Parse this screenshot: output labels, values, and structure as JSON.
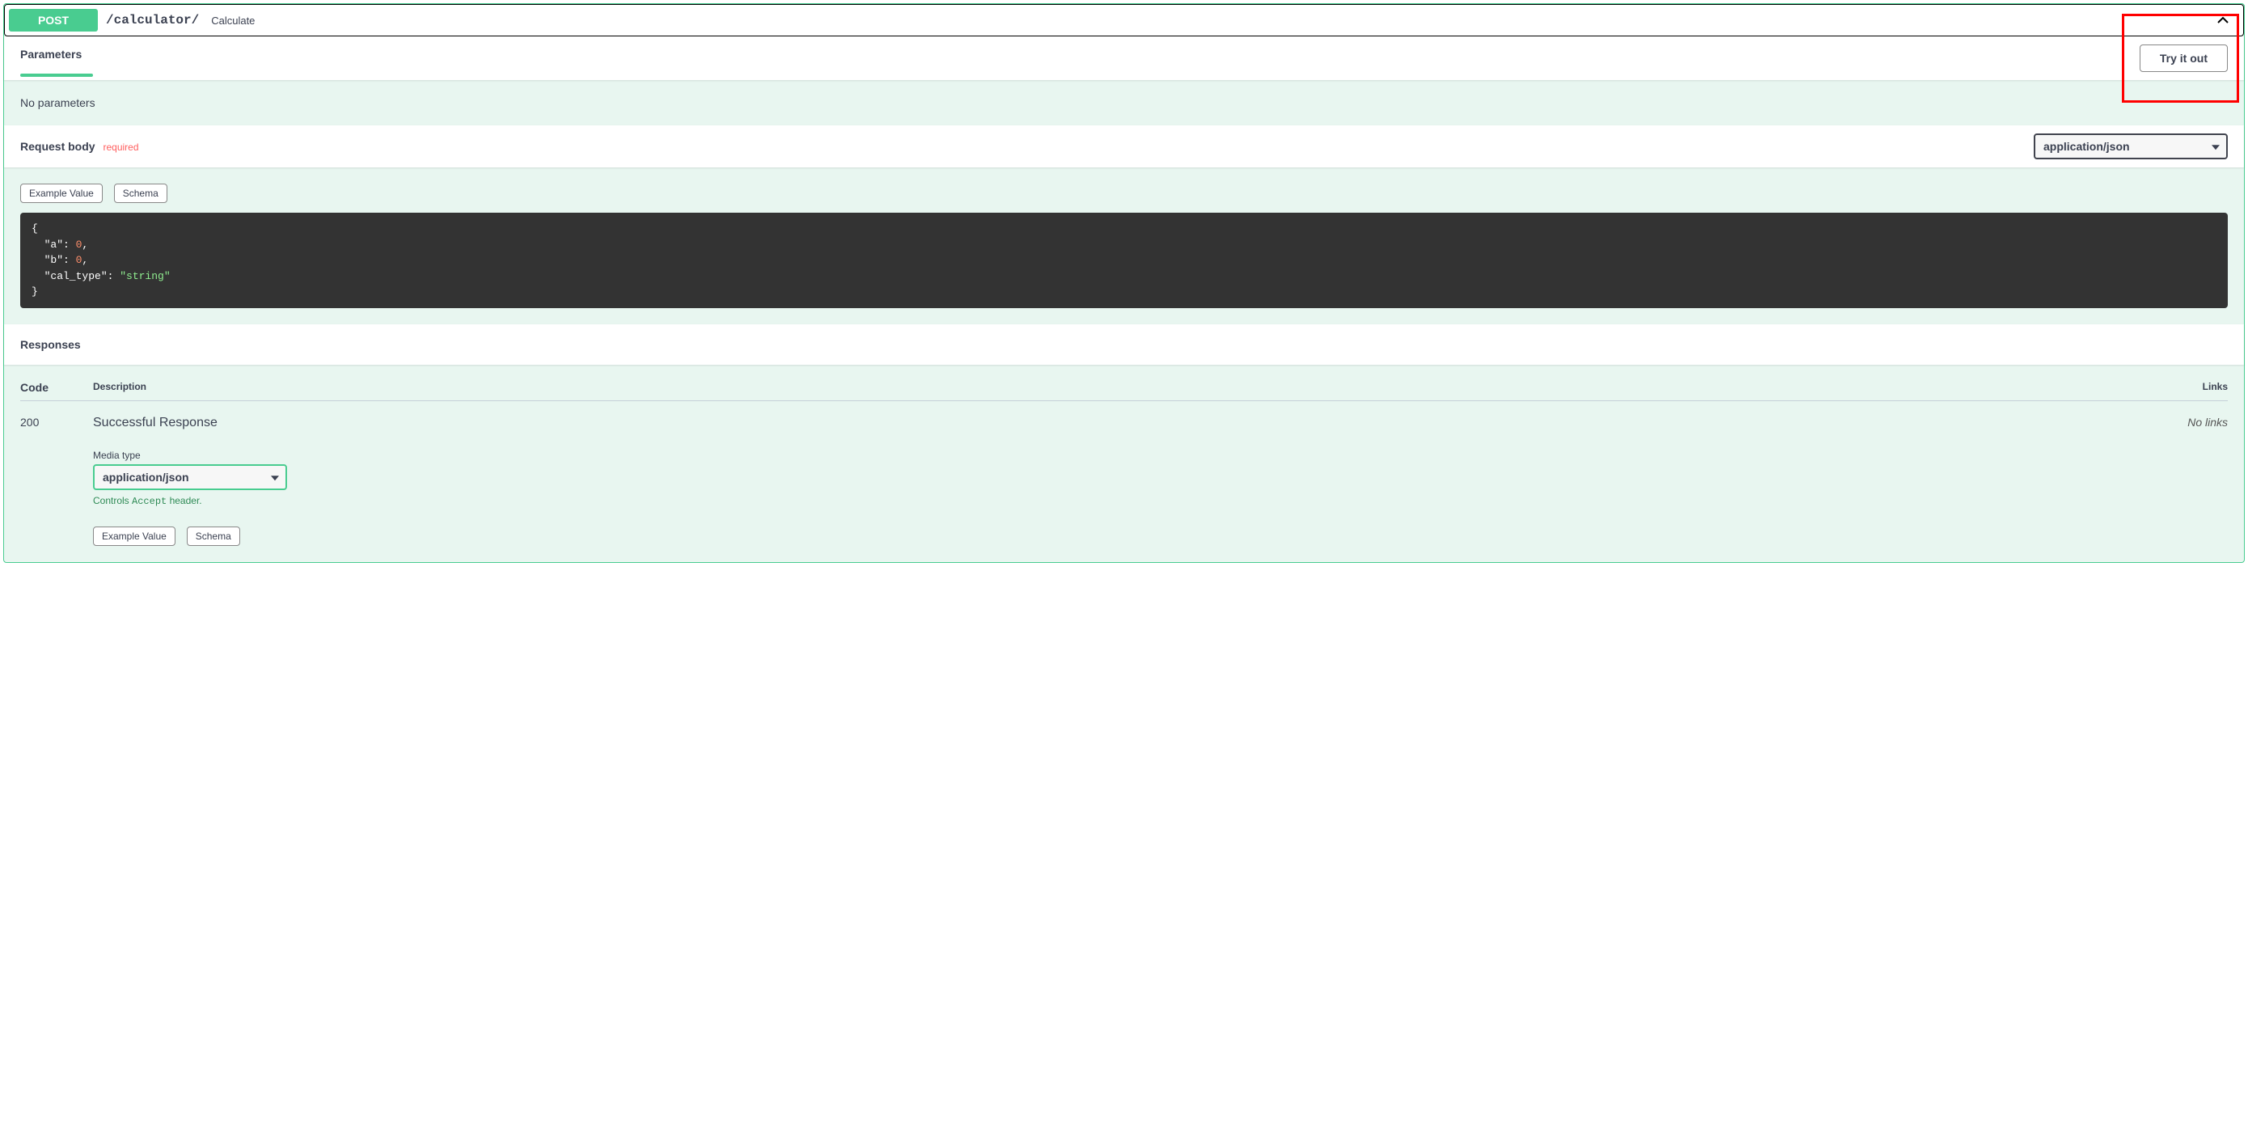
{
  "summary": {
    "method": "POST",
    "path": "/calculator/",
    "description": "Calculate"
  },
  "parameters": {
    "header_label": "Parameters",
    "try_it_out_label": "Try it out",
    "no_parameters_text": "No parameters"
  },
  "request_body": {
    "header_label": "Request body",
    "required_label": "required",
    "content_type": "application/json",
    "tabs": {
      "example_value": "Example Value",
      "schema": "Schema"
    },
    "example": {
      "a": 0,
      "b": 0,
      "cal_type": "string"
    }
  },
  "responses": {
    "header_label": "Responses",
    "columns": {
      "code": "Code",
      "description": "Description",
      "links": "Links"
    },
    "rows": [
      {
        "code": "200",
        "description": "Successful Response",
        "links": "No links",
        "media_type_label": "Media type",
        "media_type": "application/json",
        "accept_hint_prefix": "Controls ",
        "accept_hint_code": "Accept",
        "accept_hint_suffix": " header.",
        "tabs": {
          "example_value": "Example Value",
          "schema": "Schema"
        }
      }
    ]
  }
}
